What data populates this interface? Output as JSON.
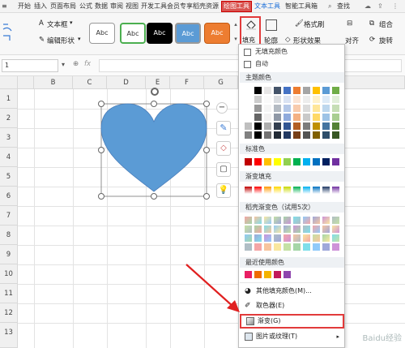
{
  "menubar": {
    "tabs": [
      "开始",
      "插入",
      "页面布局",
      "公式",
      "数据",
      "审阅",
      "视图",
      "开发工具",
      "会员专享",
      "稻壳资源"
    ],
    "active_tab": "绘图工具",
    "blue_tabs": [
      "文本工具",
      "智能工具箱"
    ],
    "search_label": "查找"
  },
  "ribbon": {
    "textbox_label": "文本框",
    "edit_shape_label": "编辑形状",
    "style_presets": [
      "Abc",
      "Abc",
      "Abc",
      "Abc",
      "Abc"
    ],
    "fill_label": "填充",
    "outline_label": "轮廓",
    "format_painter_label": "格式刷",
    "shape_effects_label": "形状效果",
    "align_label": "对齐",
    "group_label": "组合",
    "rotate_label": "旋转"
  },
  "formula_bar": {
    "name_box": "1",
    "fx": "fx"
  },
  "grid": {
    "columns": [
      "B",
      "C",
      "D",
      "E",
      "F",
      "G"
    ],
    "rows": [
      "1",
      "2",
      "3",
      "4",
      "5",
      "6",
      "7",
      "8",
      "9",
      "10",
      "11",
      "12",
      "13"
    ]
  },
  "fill_menu": {
    "no_fill": "无填充颜色",
    "auto": "自动",
    "theme_colors_title": "主题颜色",
    "standard_colors_title": "标准色",
    "gradient_fill_title": "渐变填充",
    "docer_gradient_title": "稻壳渐变色（试用5次）",
    "recent_colors_title": "最近使用颜色",
    "more_colors": "其他填充颜色(M)...",
    "eyedropper": "取色器(E)",
    "gradient": "渐变(G)",
    "picture_texture": "图片或纹理(T)"
  },
  "colors": {
    "heart_fill": "#5b9bd5",
    "highlight": "#e23b3b",
    "arrow": "#e02020"
  },
  "watermark": "Baidu经验"
}
